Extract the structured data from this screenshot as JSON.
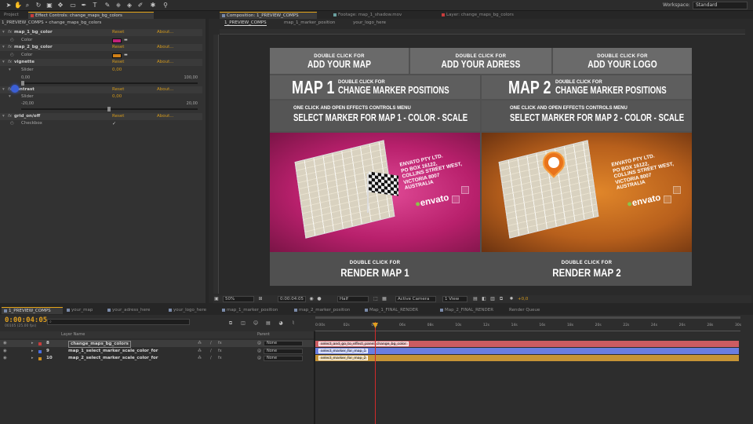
{
  "workspace": {
    "label": "Workspace:",
    "value": "Standard"
  },
  "panels_top": {
    "left_tabs": [
      "Project",
      "Effect Controls: change_maps_bg_colors"
    ],
    "comp_tabs": [
      "Composition: 1_PREVIEW_COMPS",
      "Footage: map_1_shadow.mov",
      "Layer: change_maps_bg_colors"
    ],
    "comp_subtabs": [
      "1_PREVIEW_COMPS",
      "map_1_marker_position",
      "your_logo_here"
    ]
  },
  "effect_controls": {
    "header": "1_PREVIEW_COMPS • change_maps_bg_colors",
    "reset": "Reset",
    "about": "About...",
    "fx": "fx",
    "effects": [
      {
        "name": "map_1_bg_color",
        "param": "Color",
        "color": "#c0207a"
      },
      {
        "name": "map_2_bg_color",
        "param": "Color",
        "color": "#d08018"
      },
      {
        "name": "vignette",
        "param": "Slider",
        "value": "0,00",
        "min": "0,00",
        "max": "100,00"
      },
      {
        "name": "contrast",
        "param": "Slider",
        "value": "0,00",
        "min": "-20,00",
        "max": "20,00"
      },
      {
        "name": "grid_on/off",
        "param": "Checkbox",
        "checked": "✓"
      }
    ]
  },
  "canvas": {
    "top": [
      {
        "small": "DOUBLE CLICK FOR",
        "big": "ADD YOUR MAP"
      },
      {
        "small": "DOUBLE CLICK FOR",
        "big": "ADD YOUR ADRESS"
      },
      {
        "small": "DOUBLE CLICK FOR",
        "big": "ADD YOUR LOGO"
      }
    ],
    "maps": [
      {
        "title": "MAP 1",
        "small": "DOUBLE CLICK FOR",
        "action": "CHANGE MARKER POSITIONS",
        "hint": "ONE CLICK AND OPEN EFFECTS CONTROLS MENU",
        "select": "SELECT MARKER FOR MAP 1 - COLOR - SCALE",
        "render_small": "DOUBLE CLICK FOR",
        "render": "RENDER MAP 1",
        "bg": "#b8206c"
      },
      {
        "title": "MAP 2",
        "small": "DOUBLE CLICK FOR",
        "action": "CHANGE MARKER POSITIONS",
        "hint": "ONE CLICK AND OPEN EFFECTS CONTROLS MENU",
        "select": "SELECT MARKER FOR MAP 2 - COLOR - SCALE",
        "render_small": "DOUBLE CLICK FOR",
        "render": "RENDER MAP 2",
        "bg": "#b8601c"
      }
    ],
    "address": "ENVATO PTY LTD.\nPO BOX 16122,\nCOLLINS STREET WEST,\nVICTORIA 8007\nAUSTRALIA",
    "logo": "envato"
  },
  "comp_status": {
    "zoom": "50%",
    "time": "0:00:04:05",
    "resolution": "Half",
    "camera": "Active Camera",
    "view": "1 View",
    "exposure": "+0,0"
  },
  "timeline": {
    "tabs": [
      "1_PREVIEW_COMPS",
      "your_map",
      "your_adress_here",
      "your_logo_here",
      "map_1_marker_position",
      "map_2_marker_position",
      "Map_1_FINAL_RENDER",
      "Map_2_FINAL_RENDER",
      "Render Queue"
    ],
    "time": "0:00:04:05",
    "fps": "00105 (25.00 fps)",
    "search_placeholder": "⌕",
    "col_layer_name": "Layer Name",
    "col_parent": "Parent",
    "ticks": [
      "0:00s",
      "02s",
      "04s",
      "06s",
      "08s",
      "10s",
      "12s",
      "14s",
      "16s",
      "18s",
      "20s",
      "22s",
      "24s",
      "26s",
      "28s",
      "30s"
    ],
    "layers": [
      {
        "num": "8",
        "name": "change_maps_bg_colors",
        "parent": "None",
        "label": "#c83c3c",
        "bar": "#cc5c62",
        "tag": "select_and_go_to_effect_panel_change_bg_color"
      },
      {
        "num": "9",
        "name": "map_1_select_marker_scale_color_for",
        "parent": "None",
        "label": "#4a6ee0",
        "bar": "#6a7ee0",
        "tag": "select_marker_for_map_1"
      },
      {
        "num": "10",
        "name": "map_2_select_marker_scale_color_for",
        "parent": "None",
        "label": "#d09020",
        "bar": "#c69436",
        "tag": "select_marker_for_map_2"
      }
    ]
  }
}
